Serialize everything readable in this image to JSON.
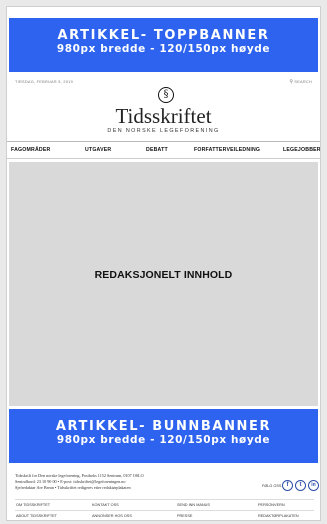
{
  "top_banner": {
    "line1": "ARTIKKEL- TOPPBANNER",
    "line2": "980px bredde - 120/150px høyde"
  },
  "header": {
    "date": "TIRSDAG, FEBRUAR 5, 2019",
    "search_label": "SEARCH",
    "logo_mark": "§",
    "brand": "Tidsskriftet",
    "brand_sub": "DEN NORSKE LEGEFORENING"
  },
  "nav": {
    "items": [
      "FAGOMRÅDER",
      "UTGAVER",
      "DEBATT",
      "FORFATTERVEILEDNING",
      "LEGEJOBBER"
    ]
  },
  "editorial": {
    "label": "REDAKSJONELT INNHOLD"
  },
  "bottom_banner": {
    "line1": "ARTIKKEL- BUNNBANNER",
    "line2": "980px bredde - 120/150px høyde"
  },
  "footer": {
    "info_line1": "Tidsskrift for Den norske legeforening, Postboks 1152 Sentrum, 0107 OSLO",
    "info_line2": "Sentralbord: 23 10 90 00 • E-post: tidsskriftet@legeforeningen.no",
    "info_line3": "Sjefredaktør Are Brean • Tidsskriftet redigeres etter redaktørplakaten",
    "follow_label": "FØLG OSS",
    "social": [
      "f",
      "t",
      "in"
    ],
    "links_row1": [
      "OM TIDSSKRIFTET",
      "KONTAKT OSS",
      "SEND INN MANUS",
      "PERSONVERN"
    ],
    "links_row2": [
      "ABOUT TIDSSKRIFTET",
      "ANNONSER HOS OSS",
      "PRESSE",
      "REDAKTØRPLAKATEN"
    ]
  },
  "colors": {
    "banner_blue": "#2d63ee",
    "editorial_gray": "#d9d9d9"
  }
}
